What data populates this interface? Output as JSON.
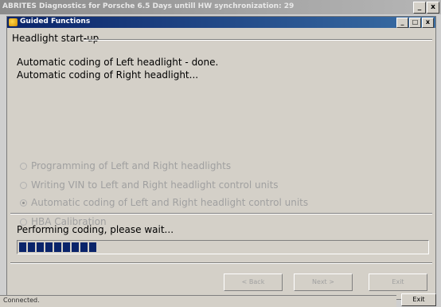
{
  "app": {
    "title": "ABRITES Diagnostics for Porsche 6.5 Days untill HW synchronization: 29",
    "controls": {
      "minimize": "_",
      "close": "x"
    }
  },
  "dialog": {
    "title": "Guided Functions",
    "controls": {
      "minimize": "_",
      "maximize": "□",
      "close": "x"
    },
    "group_title": "Headlight start-up",
    "messages": [
      "Automatic coding of Left headlight - done.",
      "Automatic coding of Right headlight..."
    ],
    "steps": [
      {
        "label": "Programming of Left and Right headlights",
        "checked": false
      },
      {
        "label": "Writing VIN to Left and Right headlight  control units",
        "checked": false
      },
      {
        "label": "Automatic coding of Left and Right headlight  control units",
        "checked": true
      },
      {
        "label": "HBA Calibration",
        "checked": false
      }
    ],
    "status_text": "Performing coding, please wait...",
    "progress": {
      "percent": 20,
      "blocks": 9,
      "color": "#0a246a"
    },
    "buttons": {
      "back": "< Back",
      "next": "Next >",
      "exit": "Exit"
    }
  },
  "statusbar": {
    "text": "Connected.",
    "exit_label": "Exit"
  }
}
